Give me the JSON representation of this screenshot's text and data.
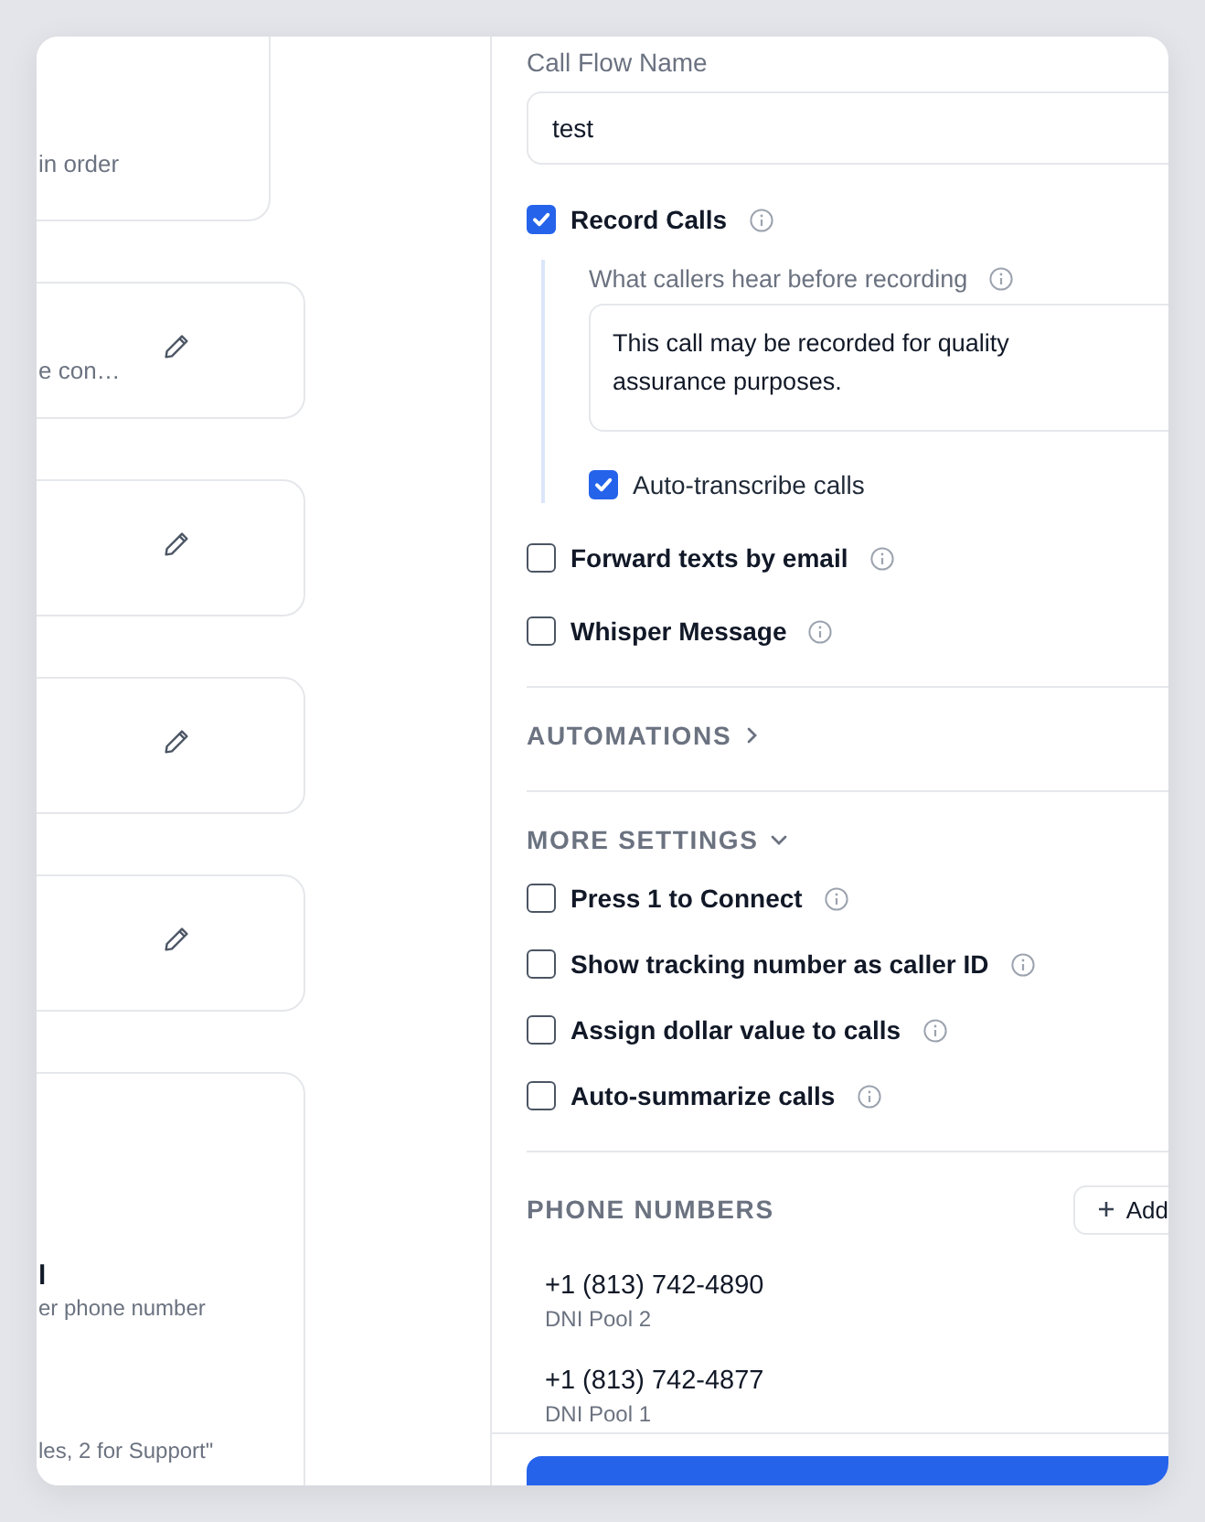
{
  "left_cards": [
    {
      "kind": "description",
      "text": "in order"
    },
    {
      "kind": "step",
      "text": "e con…"
    },
    {
      "kind": "step"
    },
    {
      "kind": "step"
    },
    {
      "kind": "step"
    },
    {
      "kind": "detail",
      "title": "l",
      "subtitle": "er phone number",
      "note": "les, 2 for Support\""
    }
  ],
  "call_flow_name": {
    "label": "Call Flow Name",
    "value": "test"
  },
  "record_calls": {
    "label": "Record Calls",
    "checked": true,
    "greeting": {
      "label": "What callers hear before recording",
      "value": "This call may be recorded for quality assurance purposes."
    },
    "auto_transcribe": {
      "label": "Auto-transcribe calls",
      "checked": true
    }
  },
  "options": [
    {
      "label": "Forward texts by email",
      "checked": false
    },
    {
      "label": "Whisper Message",
      "checked": false
    }
  ],
  "automations": {
    "label": "AUTOMATIONS",
    "expanded": false
  },
  "more_settings": {
    "label": "MORE SETTINGS",
    "expanded": true,
    "options": [
      {
        "label": "Press 1 to Connect",
        "checked": false
      },
      {
        "label": "Show tracking number as caller ID",
        "checked": false
      },
      {
        "label": "Assign dollar value to calls",
        "checked": false
      },
      {
        "label": "Auto-summarize calls",
        "checked": false
      }
    ]
  },
  "phone_numbers": {
    "label": "PHONE NUMBERS",
    "add_button": "Add",
    "items": [
      {
        "number": "+1 (813) 742-4890",
        "pool": "DNI Pool 2"
      },
      {
        "number": "+1 (813) 742-4877",
        "pool": "DNI Pool 1"
      }
    ]
  }
}
